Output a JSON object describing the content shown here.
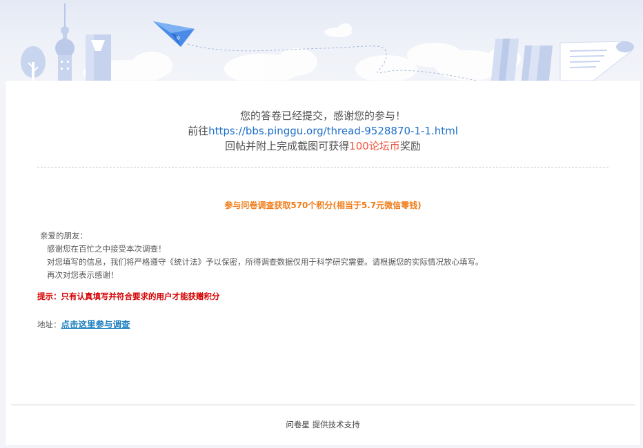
{
  "colors": {
    "background": "#f1f3f8",
    "card": "#ffffff",
    "link": "#1e6fc9",
    "reward": "#f0513d",
    "promo": "#f07c18",
    "tip": "#d40000",
    "banner_illustration": "#c5d3ee",
    "paper_plane": "#4a8be8"
  },
  "banner": {
    "icons": [
      "city-tower-icon",
      "tree-icon",
      "building-icon",
      "paper-plane-icon",
      "cloud-icon",
      "books-icon",
      "paper-scroll-icon"
    ]
  },
  "thanks": {
    "line1": "您的答卷已经提交，感谢您的参与！",
    "line2_prefix": "前往",
    "line2_link": "https://bbs.pinggu.org/thread-9528870-1-1.html",
    "line3_prefix": "回帖并附上完成截图可获得",
    "line3_amount": "100论坛币",
    "line3_suffix": "奖励"
  },
  "promo": {
    "text": "参与问卷调查获取570个积分(相当于5.7元微信零钱)"
  },
  "letter": {
    "greeting": "亲爱的朋友：",
    "line1": "感谢您在百忙之中接受本次调查！",
    "line2": "对您填写的信息，我们将严格遵守《统计法》予以保密，所得调查数据仅用于科学研究需要。请根据您的实际情况放心填写。",
    "line3": "再次对您表示感谢！"
  },
  "tip": {
    "text": "提示：只有认真填写并符合要求的用户才能获赠积分"
  },
  "address": {
    "label": "地址：",
    "link_text": "点击这里参与调查"
  },
  "footer": {
    "brand": "问卷星",
    "text": "提供技术支持"
  }
}
